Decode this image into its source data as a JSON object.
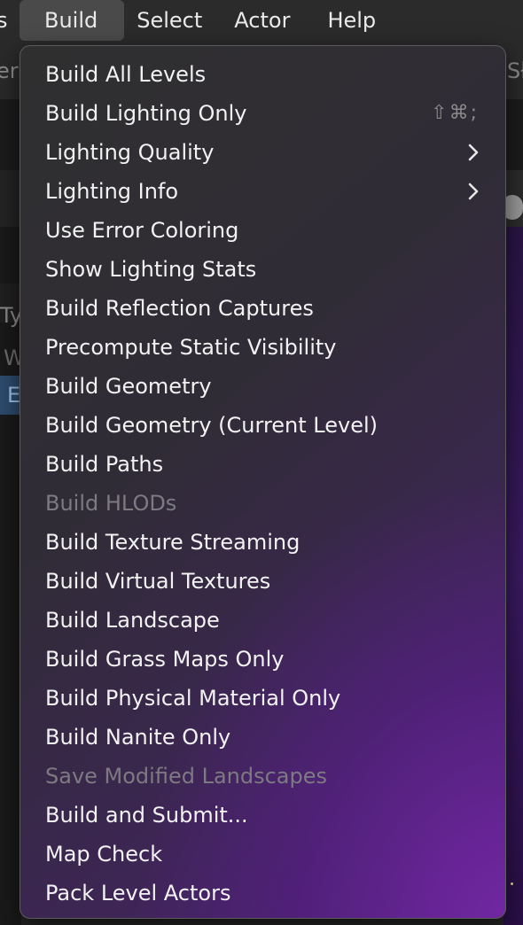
{
  "menubar": {
    "items": [
      {
        "label": "s",
        "name": "menubar-item-truncated"
      },
      {
        "label": "Build",
        "name": "menubar-item-build"
      },
      {
        "label": "Select",
        "name": "menubar-item-select"
      },
      {
        "label": "Actor",
        "name": "menubar-item-actor"
      },
      {
        "label": "Help",
        "name": "menubar-item-help"
      }
    ]
  },
  "background": {
    "toolbar_fragment_left": "er",
    "toolbar_fragment_right": "Sł",
    "panel_header_fragment": "Ty",
    "panel_row_1": "W",
    "panel_row_2": "E"
  },
  "build_menu": {
    "items": [
      {
        "label": "Build All Levels"
      },
      {
        "label": "Build Lighting Only",
        "shortcut": "⇧⌘;"
      },
      {
        "label": "Lighting Quality",
        "submenu": true
      },
      {
        "label": "Lighting Info",
        "submenu": true
      },
      {
        "label": "Use Error Coloring"
      },
      {
        "label": "Show Lighting Stats"
      },
      {
        "label": "Build Reflection Captures"
      },
      {
        "label": "Precompute Static Visibility"
      },
      {
        "label": "Build Geometry"
      },
      {
        "label": "Build Geometry (Current Level)"
      },
      {
        "label": "Build Paths"
      },
      {
        "label": "Build HLODs",
        "disabled": true
      },
      {
        "label": "Build Texture Streaming"
      },
      {
        "label": "Build Virtual Textures"
      },
      {
        "label": "Build Landscape"
      },
      {
        "label": "Build Grass Maps Only"
      },
      {
        "label": "Build Physical Material Only"
      },
      {
        "label": "Build Nanite Only"
      },
      {
        "label": "Save Modified Landscapes",
        "disabled": true
      },
      {
        "label": "Build and Submit..."
      },
      {
        "label": "Map Check"
      },
      {
        "label": "Pack Level Actors"
      }
    ]
  },
  "icons": {
    "submenu": "chevron-right-icon"
  },
  "colors": {
    "menu_text": "#f2f2f2",
    "disabled_text": "#7d7a82",
    "menubar_active": "#4a4a4a",
    "viewport_purple": "#3a1a62"
  }
}
